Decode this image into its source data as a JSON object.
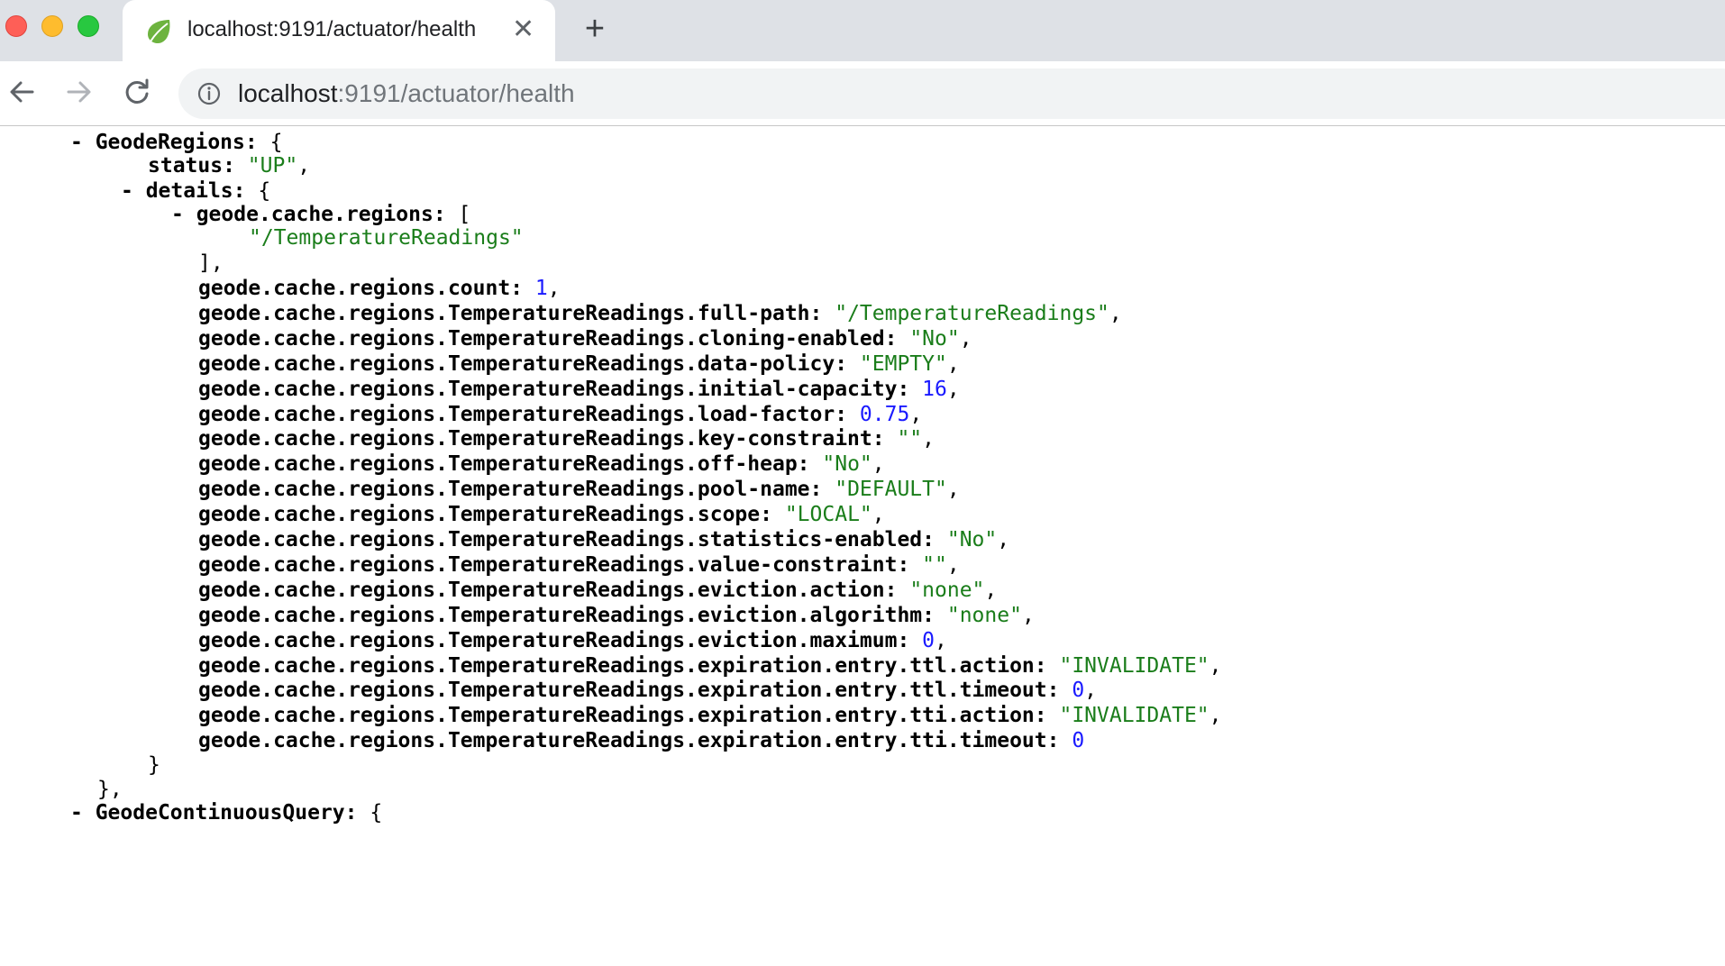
{
  "browser": {
    "tab": {
      "title": "localhost:9191/actuator/health",
      "favicon": "spring-leaf-icon",
      "close_glyph": "✕"
    },
    "new_tab_glyph": "+",
    "url": {
      "host": "localhost",
      "rest": ":9191/actuator/health"
    },
    "colors": {
      "tabstrip": "#dee1e6",
      "string": "#1a7d1a",
      "number": "#1a1aff"
    }
  },
  "json_view": {
    "geode_regions_key": "GeodeRegions",
    "status_key": "status",
    "status_value": "\"UP\"",
    "details_key": "details",
    "regions_list_key": "geode.cache.regions",
    "regions_list": [
      "\"/TemperatureReadings\""
    ],
    "properties": [
      {
        "key": "geode.cache.regions.count",
        "value": "1",
        "kind": "num"
      },
      {
        "key": "geode.cache.regions.TemperatureReadings.full-path",
        "value": "\"/TemperatureReadings\"",
        "kind": "str"
      },
      {
        "key": "geode.cache.regions.TemperatureReadings.cloning-enabled",
        "value": "\"No\"",
        "kind": "str"
      },
      {
        "key": "geode.cache.regions.TemperatureReadings.data-policy",
        "value": "\"EMPTY\"",
        "kind": "str"
      },
      {
        "key": "geode.cache.regions.TemperatureReadings.initial-capacity",
        "value": "16",
        "kind": "num"
      },
      {
        "key": "geode.cache.regions.TemperatureReadings.load-factor",
        "value": "0.75",
        "kind": "num"
      },
      {
        "key": "geode.cache.regions.TemperatureReadings.key-constraint",
        "value": "\"\"",
        "kind": "str"
      },
      {
        "key": "geode.cache.regions.TemperatureReadings.off-heap",
        "value": "\"No\"",
        "kind": "str"
      },
      {
        "key": "geode.cache.regions.TemperatureReadings.pool-name",
        "value": "\"DEFAULT\"",
        "kind": "str"
      },
      {
        "key": "geode.cache.regions.TemperatureReadings.scope",
        "value": "\"LOCAL\"",
        "kind": "str"
      },
      {
        "key": "geode.cache.regions.TemperatureReadings.statistics-enabled",
        "value": "\"No\"",
        "kind": "str"
      },
      {
        "key": "geode.cache.regions.TemperatureReadings.value-constraint",
        "value": "\"\"",
        "kind": "str"
      },
      {
        "key": "geode.cache.regions.TemperatureReadings.eviction.action",
        "value": "\"none\"",
        "kind": "str"
      },
      {
        "key": "geode.cache.regions.TemperatureReadings.eviction.algorithm",
        "value": "\"none\"",
        "kind": "str"
      },
      {
        "key": "geode.cache.regions.TemperatureReadings.eviction.maximum",
        "value": "0",
        "kind": "num"
      },
      {
        "key": "geode.cache.regions.TemperatureReadings.expiration.entry.ttl.action",
        "value": "\"INVALIDATE\"",
        "kind": "str"
      },
      {
        "key": "geode.cache.regions.TemperatureReadings.expiration.entry.ttl.timeout",
        "value": "0",
        "kind": "num"
      },
      {
        "key": "geode.cache.regions.TemperatureReadings.expiration.entry.tti.action",
        "value": "\"INVALIDATE\"",
        "kind": "str"
      },
      {
        "key": "geode.cache.regions.TemperatureReadings.expiration.entry.tti.timeout",
        "value": "0",
        "kind": "num"
      }
    ],
    "continuous_query_key": "GeodeContinuousQuery"
  }
}
